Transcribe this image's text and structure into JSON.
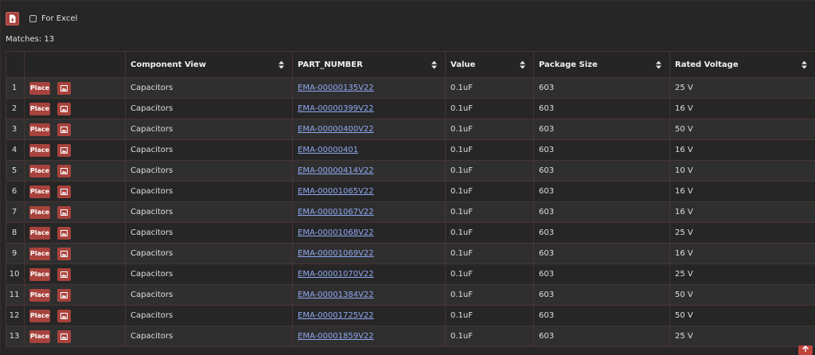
{
  "toolbar": {
    "for_excel_label": "For Excel",
    "export_icon": "file-export-icon"
  },
  "matches_text": "Matches: 13",
  "table": {
    "headers": [
      "Component View",
      "PART_NUMBER",
      "Value",
      "Package Size",
      "Rated Voltage"
    ],
    "place_label": "Place",
    "rows": [
      {
        "n": "1",
        "view": "Capacitors",
        "part": "EMA-00000135V22",
        "value": "0.1uF",
        "pkg": "603",
        "volt": "25 V"
      },
      {
        "n": "2",
        "view": "Capacitors",
        "part": "EMA-00000399V22",
        "value": "0.1uF",
        "pkg": "603",
        "volt": "16 V"
      },
      {
        "n": "3",
        "view": "Capacitors",
        "part": "EMA-00000400V22",
        "value": "0.1uF",
        "pkg": "603",
        "volt": "50 V"
      },
      {
        "n": "4",
        "view": "Capacitors",
        "part": "EMA-00000401",
        "value": "0.1uF",
        "pkg": "603",
        "volt": "16 V"
      },
      {
        "n": "5",
        "view": "Capacitors",
        "part": "EMA-00000414V22",
        "value": "0.1uF",
        "pkg": "603",
        "volt": "10 V"
      },
      {
        "n": "6",
        "view": "Capacitors",
        "part": "EMA-00001065V22",
        "value": "0.1uF",
        "pkg": "603",
        "volt": "16 V"
      },
      {
        "n": "7",
        "view": "Capacitors",
        "part": "EMA-00001067V22",
        "value": "0.1uF",
        "pkg": "603",
        "volt": "16 V"
      },
      {
        "n": "8",
        "view": "Capacitors",
        "part": "EMA-00001068V22",
        "value": "0.1uF",
        "pkg": "603",
        "volt": "25 V"
      },
      {
        "n": "9",
        "view": "Capacitors",
        "part": "EMA-00001069V22",
        "value": "0.1uF",
        "pkg": "603",
        "volt": "16 V"
      },
      {
        "n": "10",
        "view": "Capacitors",
        "part": "EMA-00001070V22",
        "value": "0.1uF",
        "pkg": "603",
        "volt": "25 V"
      },
      {
        "n": "11",
        "view": "Capacitors",
        "part": "EMA-00001384V22",
        "value": "0.1uF",
        "pkg": "603",
        "volt": "50 V"
      },
      {
        "n": "12",
        "view": "Capacitors",
        "part": "EMA-00001725V22",
        "value": "0.1uF",
        "pkg": "603",
        "volt": "50 V"
      },
      {
        "n": "13",
        "view": "Capacitors",
        "part": "EMA-00001859V22",
        "value": "0.1uF",
        "pkg": "603",
        "volt": "25 V"
      }
    ]
  },
  "colors": {
    "accent": "#a8423c",
    "link": "#8fa8f0",
    "background": "#262626"
  }
}
